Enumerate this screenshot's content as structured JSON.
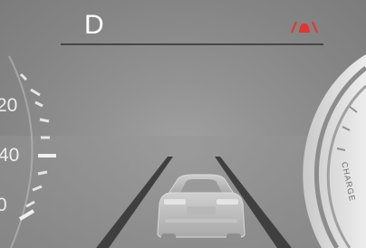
{
  "drive": {
    "gear": "D"
  },
  "icons": {
    "lane_assist": "lane-assist-icon"
  },
  "colors": {
    "accent_red": "#e2352f",
    "background": "#8f8f8f",
    "text": "#ffffff"
  },
  "speedometer": {
    "tick_labels": [
      "20",
      "40",
      "0"
    ]
  },
  "power_meter": {
    "zone_label": "CHARGE"
  }
}
